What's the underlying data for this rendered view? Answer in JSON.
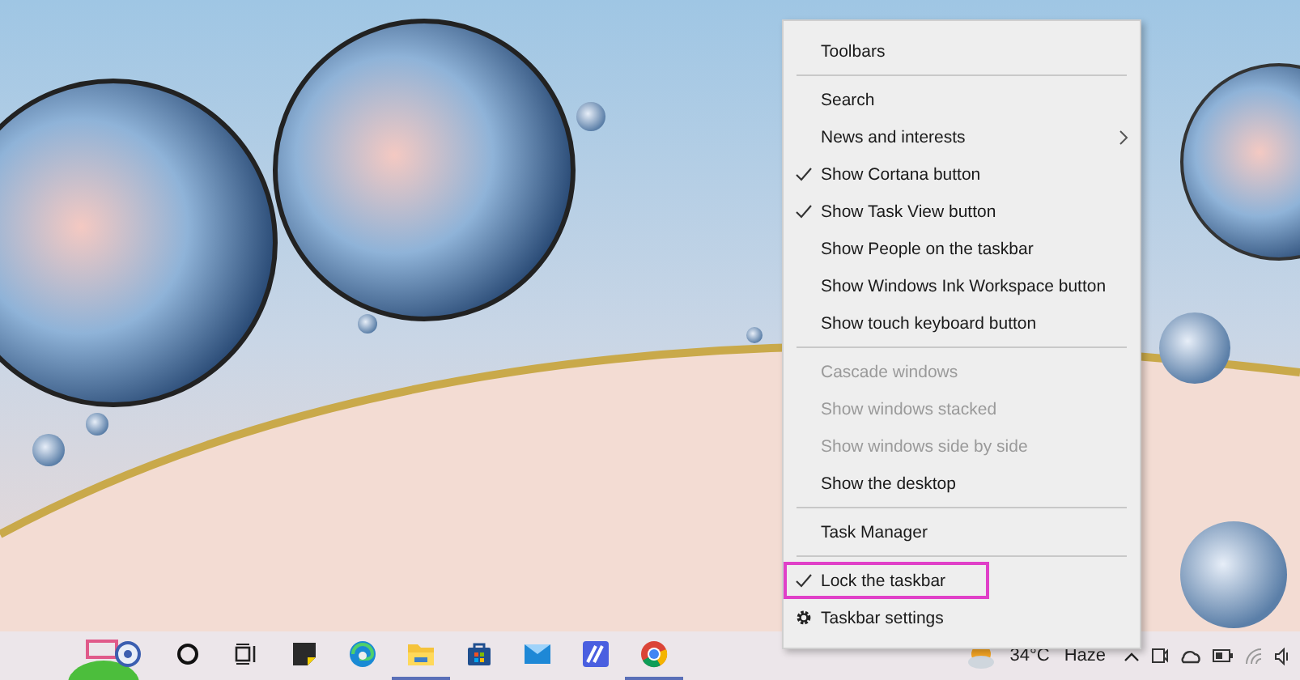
{
  "context_menu": {
    "items": [
      {
        "kind": "item",
        "label": "Toolbars",
        "checked": false,
        "disabled": false,
        "submenu": false,
        "highlighted": false
      },
      {
        "kind": "separator"
      },
      {
        "kind": "item",
        "label": "Search",
        "checked": false,
        "disabled": false,
        "submenu": false,
        "highlighted": false
      },
      {
        "kind": "item",
        "label": "News and interests",
        "checked": false,
        "disabled": false,
        "submenu": true,
        "highlighted": false
      },
      {
        "kind": "item",
        "label": "Show Cortana button",
        "checked": true,
        "disabled": false,
        "submenu": false,
        "highlighted": false
      },
      {
        "kind": "item",
        "label": "Show Task View button",
        "checked": true,
        "disabled": false,
        "submenu": false,
        "highlighted": false
      },
      {
        "kind": "item",
        "label": "Show People on the taskbar",
        "checked": false,
        "disabled": false,
        "submenu": false,
        "highlighted": false
      },
      {
        "kind": "item",
        "label": "Show Windows Ink Workspace button",
        "checked": false,
        "disabled": false,
        "submenu": false,
        "highlighted": false
      },
      {
        "kind": "item",
        "label": "Show touch keyboard button",
        "checked": false,
        "disabled": false,
        "submenu": false,
        "highlighted": false
      },
      {
        "kind": "separator"
      },
      {
        "kind": "item",
        "label": "Cascade windows",
        "checked": false,
        "disabled": true,
        "submenu": false,
        "highlighted": false
      },
      {
        "kind": "item",
        "label": "Show windows stacked",
        "checked": false,
        "disabled": true,
        "submenu": false,
        "highlighted": false
      },
      {
        "kind": "item",
        "label": "Show windows side by side",
        "checked": false,
        "disabled": true,
        "submenu": false,
        "highlighted": false
      },
      {
        "kind": "item",
        "label": "Show the desktop",
        "checked": false,
        "disabled": false,
        "submenu": false,
        "highlighted": false
      },
      {
        "kind": "separator"
      },
      {
        "kind": "item",
        "label": "Task Manager",
        "checked": false,
        "disabled": false,
        "submenu": false,
        "highlighted": false
      },
      {
        "kind": "separator"
      },
      {
        "kind": "item",
        "label": "Lock the taskbar",
        "checked": true,
        "disabled": false,
        "submenu": false,
        "highlighted": true
      },
      {
        "kind": "settings",
        "label": "Taskbar settings",
        "checked": false,
        "disabled": false,
        "submenu": false,
        "highlighted": false
      }
    ]
  },
  "taskbar": {
    "apps": [
      {
        "kind": "cortana",
        "running": false
      },
      {
        "kind": "taskview",
        "running": false
      },
      {
        "kind": "notes",
        "running": false
      },
      {
        "kind": "edge",
        "running": false
      },
      {
        "kind": "explorer",
        "running": true
      },
      {
        "kind": "store",
        "running": false
      },
      {
        "kind": "mail",
        "running": false
      },
      {
        "kind": "editor",
        "running": false
      },
      {
        "kind": "chrome",
        "running": true
      }
    ],
    "weather": {
      "temperature": "34°C",
      "condition": "Haze"
    }
  }
}
